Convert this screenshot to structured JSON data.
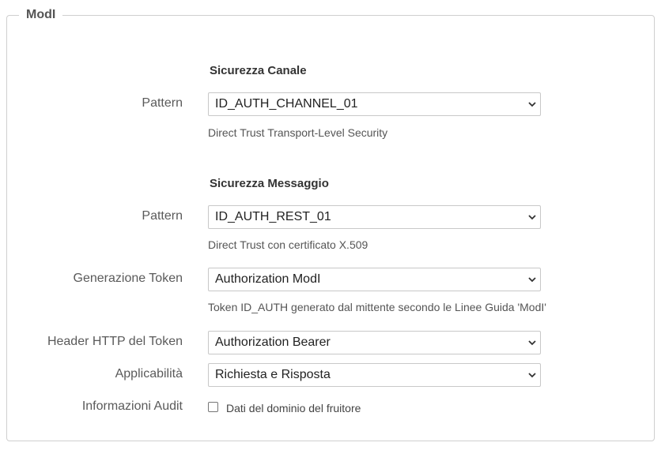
{
  "panel": {
    "legend": "ModI"
  },
  "channel": {
    "title": "Sicurezza Canale",
    "pattern": {
      "label": "Pattern",
      "value": "ID_AUTH_CHANNEL_01",
      "hint": "Direct Trust Transport-Level Security"
    }
  },
  "message": {
    "title": "Sicurezza Messaggio",
    "pattern": {
      "label": "Pattern",
      "value": "ID_AUTH_REST_01",
      "hint": "Direct Trust con certificato X.509"
    },
    "token_generation": {
      "label": "Generazione Token",
      "value": "Authorization ModI",
      "hint": "Token ID_AUTH generato dal mittente secondo le Linee Guida 'ModI'"
    },
    "token_header": {
      "label": "Header HTTP del Token",
      "value": "Authorization Bearer"
    },
    "applicability": {
      "label": "Applicabilità",
      "value": "Richiesta e Risposta"
    },
    "audit": {
      "label": "Informazioni Audit",
      "checkbox_label": "Dati del dominio del fruitore",
      "checked": false
    }
  },
  "icons": {
    "select": "chevron-down-icon"
  }
}
